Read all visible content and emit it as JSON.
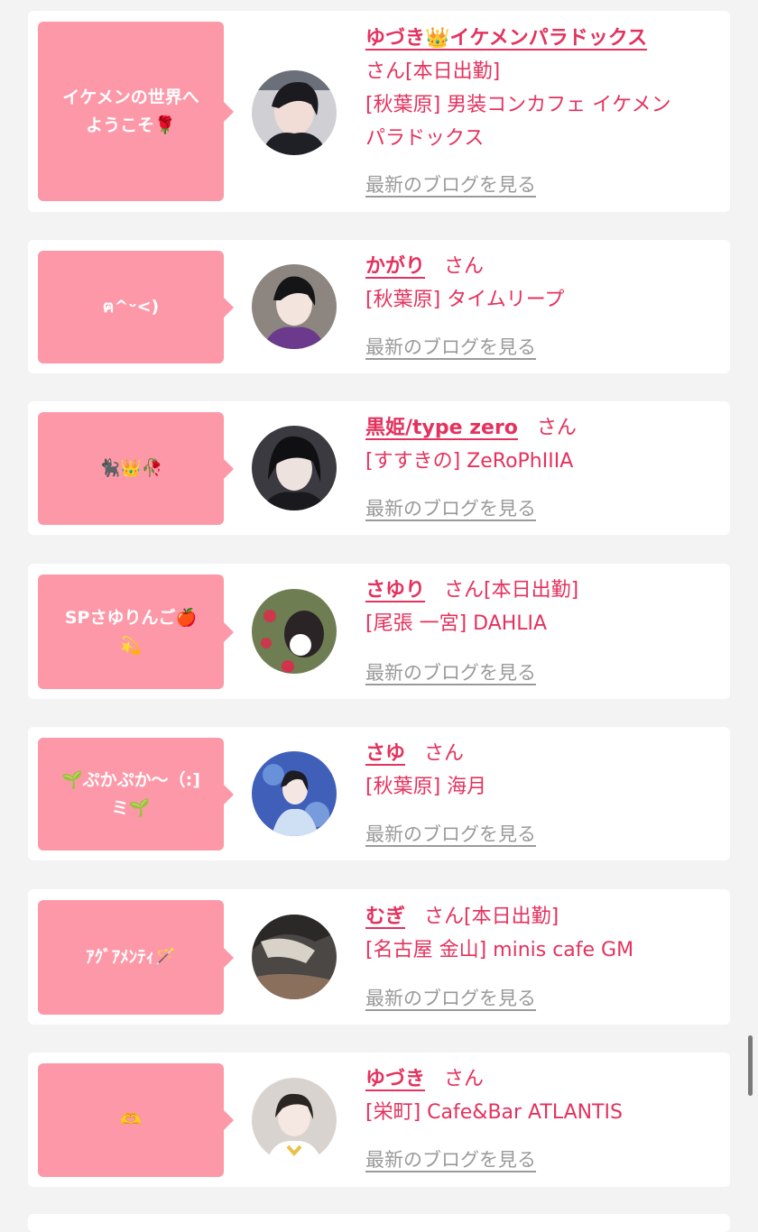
{
  "colors": {
    "accent": "#e4325e",
    "bubble": "#fd98a8",
    "link_gray": "#9a9a9a"
  },
  "entries": [
    {
      "bubble": [
        "イケメンの世界へ",
        "ようこそ🌹"
      ],
      "name": "ゆづき👑イケメンパラドックス",
      "lines": [
        "さん[本日出勤]",
        "[秋葉原] 男装コンカフェ イケメン",
        "パラドックス"
      ],
      "blog": "最新のブログを見る"
    },
    {
      "bubble": [
        "ฅ^ᵕ<)"
      ],
      "name": "かがり",
      "suffix": "さん",
      "lines": [
        "[秋葉原] タイムリープ"
      ],
      "blog": "最新のブログを見る"
    },
    {
      "bubble": [
        "🐈‍⬛👑🥀"
      ],
      "name": "黒姫/type zero",
      "suffix": "さん",
      "lines": [
        "[すすきの] ZeRoPhIIIA"
      ],
      "blog": "最新のブログを見る"
    },
    {
      "bubble": [
        "SPさゆりんご🍎",
        "💫"
      ],
      "name": "さゆり",
      "suffix": "さん[本日出勤]",
      "lines": [
        "[尾張 一宮] DAHLIA"
      ],
      "blog": "最新のブログを見る"
    },
    {
      "bubble": [
        "🌱ぷかぷか〜（:]",
        "ミ🌱"
      ],
      "name": "さゆ",
      "suffix": "さん",
      "lines": [
        "[秋葉原] 海月"
      ],
      "blog": "最新のブログを見る"
    },
    {
      "bubble": [
        "ｱｸﾞｱﾒﾝﾃｨ🪄"
      ],
      "name": "むぎ",
      "suffix": "さん[本日出勤]",
      "lines": [
        "[名古屋 金山] minis cafe GM"
      ],
      "blog": "最新のブログを見る"
    },
    {
      "bubble": [
        "🫶"
      ],
      "name": "ゆづき",
      "suffix": "さん",
      "lines": [
        "[栄町] Cafe&Bar ATLANTIS"
      ],
      "blog": "最新のブログを見る"
    }
  ]
}
